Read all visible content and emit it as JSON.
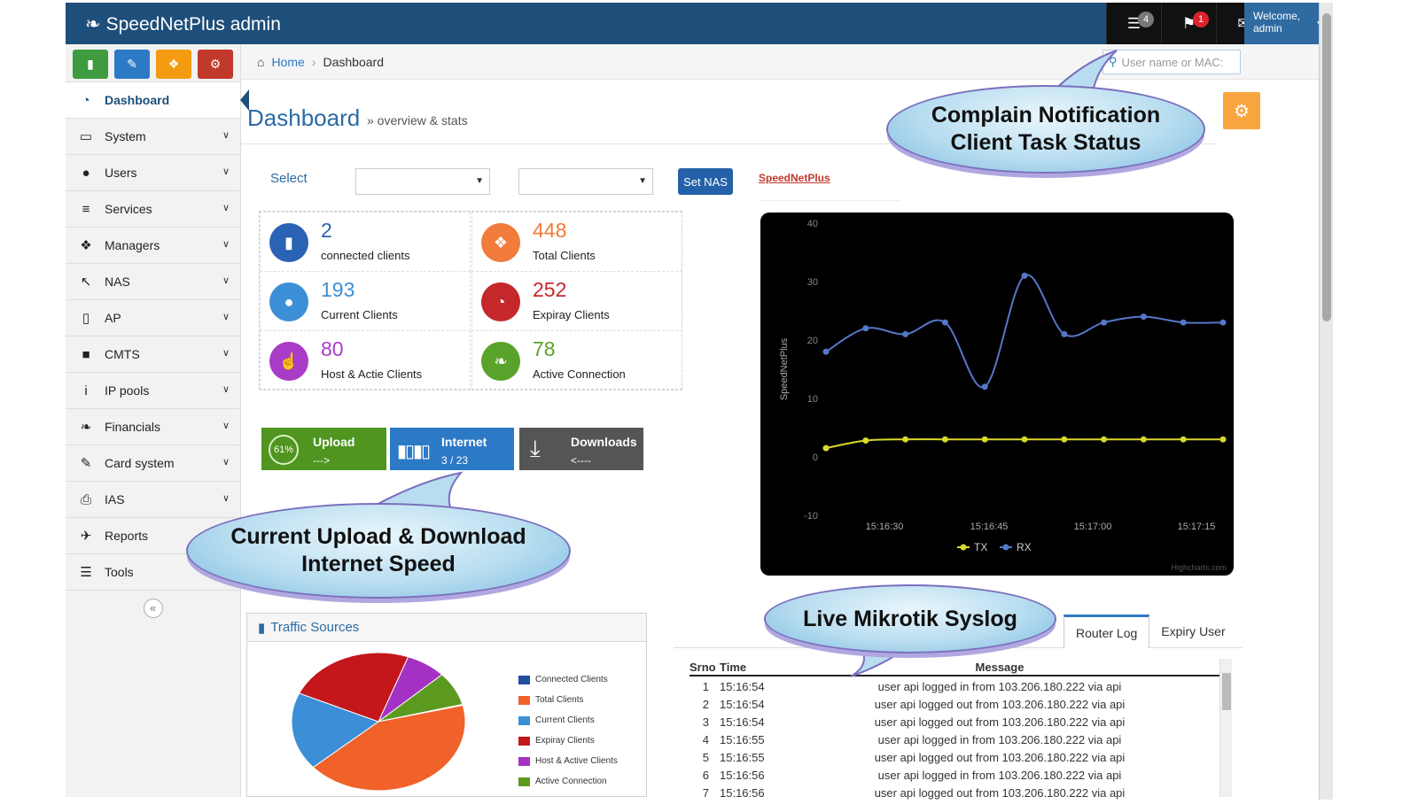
{
  "app": {
    "title": "SpeedNetPlus admin"
  },
  "topbar": {
    "tasks_count": "4",
    "notifications_count": "1",
    "messages_count": "0",
    "welcome_line1": "Welcome,",
    "welcome_line2": "admin",
    "colors": {
      "tasks_badge": "#777777",
      "notifications_badge": "#d9232d",
      "messages_badge": "#3f9b3f"
    }
  },
  "sidebar": {
    "shortcut_icons": [
      "signal-icon",
      "pencil-icon",
      "group-icon",
      "cogs-icon"
    ],
    "items": [
      {
        "label": "Dashboard",
        "icon": "dashboard-icon",
        "glyph": "◔",
        "active": true,
        "has_submenu": false
      },
      {
        "label": "System",
        "icon": "desktop-icon",
        "glyph": "▭",
        "active": false,
        "has_submenu": true
      },
      {
        "label": "Users",
        "icon": "user-icon",
        "glyph": "●",
        "active": false,
        "has_submenu": true
      },
      {
        "label": "Services",
        "icon": "server-icon",
        "glyph": "≡",
        "active": false,
        "has_submenu": true
      },
      {
        "label": "Managers",
        "icon": "users-icon",
        "glyph": "❖",
        "active": false,
        "has_submenu": true
      },
      {
        "label": "NAS",
        "icon": "cursor-icon",
        "glyph": "↖",
        "active": false,
        "has_submenu": true
      },
      {
        "label": "AP",
        "icon": "mobile-icon",
        "glyph": "▯",
        "active": false,
        "has_submenu": true
      },
      {
        "label": "CMTS",
        "icon": "lock-icon",
        "glyph": "■",
        "active": false,
        "has_submenu": true
      },
      {
        "label": "IP pools",
        "icon": "info-icon",
        "glyph": "i",
        "active": false,
        "has_submenu": true
      },
      {
        "label": "Financials",
        "icon": "leaf-icon",
        "glyph": "❧",
        "active": false,
        "has_submenu": true
      },
      {
        "label": "Card system",
        "icon": "pencil-icon",
        "glyph": "✎",
        "active": false,
        "has_submenu": true
      },
      {
        "label": "IAS",
        "icon": "print-icon",
        "glyph": "⎙",
        "active": false,
        "has_submenu": true
      },
      {
        "label": "Reports",
        "icon": "plane-icon",
        "glyph": "✈",
        "active": false,
        "has_submenu": false
      },
      {
        "label": "Tools",
        "icon": "list-icon",
        "glyph": "☰",
        "active": false,
        "has_submenu": false
      }
    ],
    "collapse_glyph": "«"
  },
  "breadcrumb": {
    "home": "Home",
    "current": "Dashboard"
  },
  "search": {
    "placeholder": "User name or MAC:"
  },
  "page": {
    "title": "Dashboard",
    "subtitle": "» overview & stats"
  },
  "filters": {
    "select_label": "Select",
    "select1_value": "",
    "select2_value": "",
    "set_nas_label": "Set NAS",
    "speednetplus_link": "SpeedNetPlus"
  },
  "stats": [
    {
      "value": "2",
      "label": "connected clients",
      "icon": "signal-icon",
      "color": "#2a62b4"
    },
    {
      "value": "448",
      "label": "Total Clients",
      "icon": "group-icon",
      "color": "#f07b3a"
    },
    {
      "value": "193",
      "label": "Current Clients",
      "icon": "user-icon",
      "color": "#3c8fd6"
    },
    {
      "value": "252",
      "label": "Expiray Clients",
      "icon": "dashboard-icon",
      "color": "#c4282b"
    },
    {
      "value": "80",
      "label": "Host & Actie Clients",
      "icon": "thumbs-up-icon",
      "color": "#a93cc6"
    },
    {
      "value": "78",
      "label": "Active Connection",
      "icon": "leaf-icon",
      "color": "#5aa32a"
    }
  ],
  "speed_bars": {
    "upload": {
      "label": "Upload",
      "percent": "61%",
      "arrow": "--->",
      "color": "#4f9520"
    },
    "internet": {
      "label": "Internet",
      "value": "3 / 23",
      "color": "#2c7ac6"
    },
    "downloads": {
      "label": "Downloads",
      "arrow": "<----",
      "color": "#555555"
    }
  },
  "chart_data": {
    "type": "line",
    "title": "",
    "xlabel": "",
    "ylabel": "SpeedNetPlus",
    "ylim": [
      -10,
      40
    ],
    "y_ticks": [
      "-10",
      "0",
      "10",
      "20",
      "30",
      "40"
    ],
    "x_ticks": [
      "15:16:30",
      "15:16:45",
      "15:17:00",
      "15:17:15"
    ],
    "x": [
      0,
      5,
      10,
      15,
      20,
      25,
      30,
      35,
      40,
      45,
      50
    ],
    "series": [
      {
        "name": "TX",
        "color": "#d9d92b",
        "values": [
          1.5,
          2.8,
          3,
          3,
          3,
          3,
          3,
          3,
          3,
          3,
          3
        ]
      },
      {
        "name": "RX",
        "color": "#5577c9",
        "values": [
          18,
          22,
          21,
          23,
          12,
          31,
          21,
          23,
          24,
          23,
          23
        ]
      }
    ],
    "legend_position": "bottom-center",
    "grid": false,
    "credits": "Highcharts.com"
  },
  "traffic": {
    "title": "Traffic Sources",
    "chart_data": {
      "type": "pie",
      "categories": [
        "Connected Clients",
        "Total Clients",
        "Current Clients",
        "Expiray Clients",
        "Host & Active Clients",
        "Active Connection"
      ],
      "values": [
        0.2,
        42.3,
        18.2,
        23.8,
        7.5,
        7.9
      ],
      "colors": [
        "#1f4f9e",
        "#f0622a",
        "#3c8fd6",
        "#c3171b",
        "#a531c4",
        "#5c9a1f"
      ]
    }
  },
  "tabs": [
    {
      "label": "Router Log",
      "active": true
    },
    {
      "label": "Expiry User",
      "active": false
    }
  ],
  "log": {
    "headers": {
      "srno": "Srno",
      "time": "Time",
      "message": "Message"
    },
    "rows": [
      {
        "srno": "1",
        "time": "15:16:54",
        "message": "user api logged in from 103.206.180.222 via api"
      },
      {
        "srno": "2",
        "time": "15:16:54",
        "message": "user api logged out from 103.206.180.222 via api"
      },
      {
        "srno": "3",
        "time": "15:16:54",
        "message": "user api logged out from 103.206.180.222 via api"
      },
      {
        "srno": "4",
        "time": "15:16:55",
        "message": "user api logged in from 103.206.180.222 via api"
      },
      {
        "srno": "5",
        "time": "15:16:55",
        "message": "user api logged out from 103.206.180.222 via api"
      },
      {
        "srno": "6",
        "time": "15:16:56",
        "message": "user api logged in from 103.206.180.222 via api"
      },
      {
        "srno": "7",
        "time": "15:16:56",
        "message": "user api logged out from 103.206.180.222 via api"
      }
    ]
  },
  "callouts": {
    "complain": {
      "line1": "Complain Notification",
      "line2": "Client Task Status"
    },
    "speed": {
      "line1": "Current Upload & Download",
      "line2": "Internet Speed"
    },
    "syslog": {
      "line1": "Live Mikrotik Syslog"
    }
  }
}
